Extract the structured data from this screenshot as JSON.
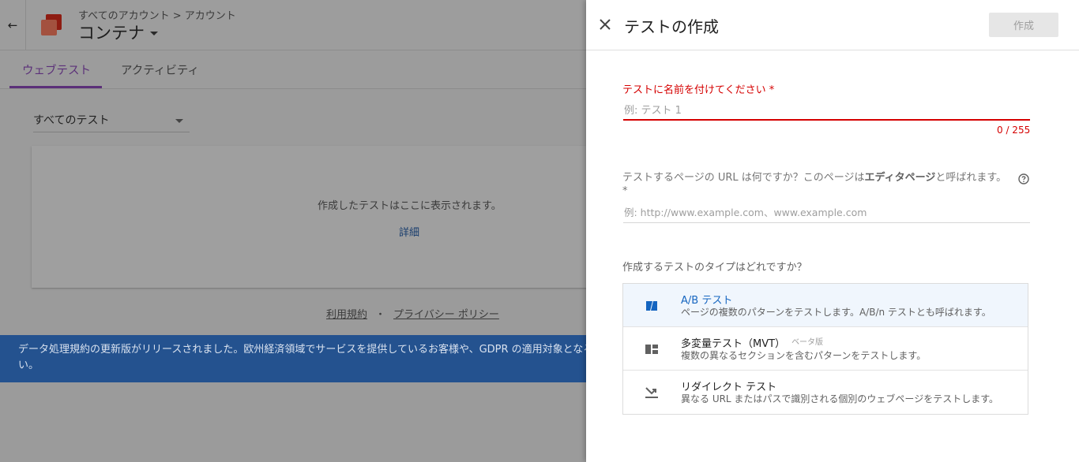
{
  "header": {
    "breadcrumb": "すべてのアカウント > アカウント",
    "title": "コンテナ"
  },
  "tabs": [
    {
      "label": "ウェブテスト",
      "active": true
    },
    {
      "label": "アクティビティ",
      "active": false
    }
  ],
  "filter": {
    "selected": "すべてのテスト"
  },
  "empty_state": {
    "message": "作成したテストはここに表示されます。",
    "link": "詳細"
  },
  "footer": {
    "terms": "利用規約",
    "separator": "・",
    "privacy": "プライバシー ポリシー"
  },
  "notice": {
    "text": "データ処理規約の更新版がリリースされました。欧州経済領域でサービスを提供しているお客様や、GDPR の適用対象となる",
    "text_cont": "い。"
  },
  "drawer": {
    "title": "テストの作成",
    "create_button": "作成",
    "name_field": {
      "label": "テストに名前を付けてください *",
      "placeholder": "例: テスト 1",
      "value": "",
      "counter": "0 / 255"
    },
    "url_field": {
      "label_pre": "テストするページの URL は何ですか？このページは",
      "label_bold": "エディタページ",
      "label_post": "と呼ばれます。",
      "label_required": "*",
      "placeholder": "例: http://www.example.com、www.example.com",
      "value": ""
    },
    "type_question": "作成するテストのタイプはどれですか？",
    "test_types": [
      {
        "name": "A/B テスト",
        "description": "ページの複数のパターンをテストします。A/B/n テストとも呼ばれます。",
        "icon": "ab-test-icon",
        "selected": true,
        "badge": ""
      },
      {
        "name": "多変量テスト（MVT）",
        "description": "複数の異なるセクションを含むパターンをテストします。",
        "icon": "mvt-grid-icon",
        "selected": false,
        "badge": "ベータ版"
      },
      {
        "name": "リダイレクト テスト",
        "description": "異なる URL またはパスで識別される個別のウェブページをテストします。",
        "icon": "redirect-arrow-icon",
        "selected": false,
        "badge": ""
      }
    ]
  },
  "colors": {
    "error_red": "#d50000",
    "accent_blue": "#1565c0",
    "tab_purple": "#5b3079",
    "notice_bg": "#24528f"
  }
}
